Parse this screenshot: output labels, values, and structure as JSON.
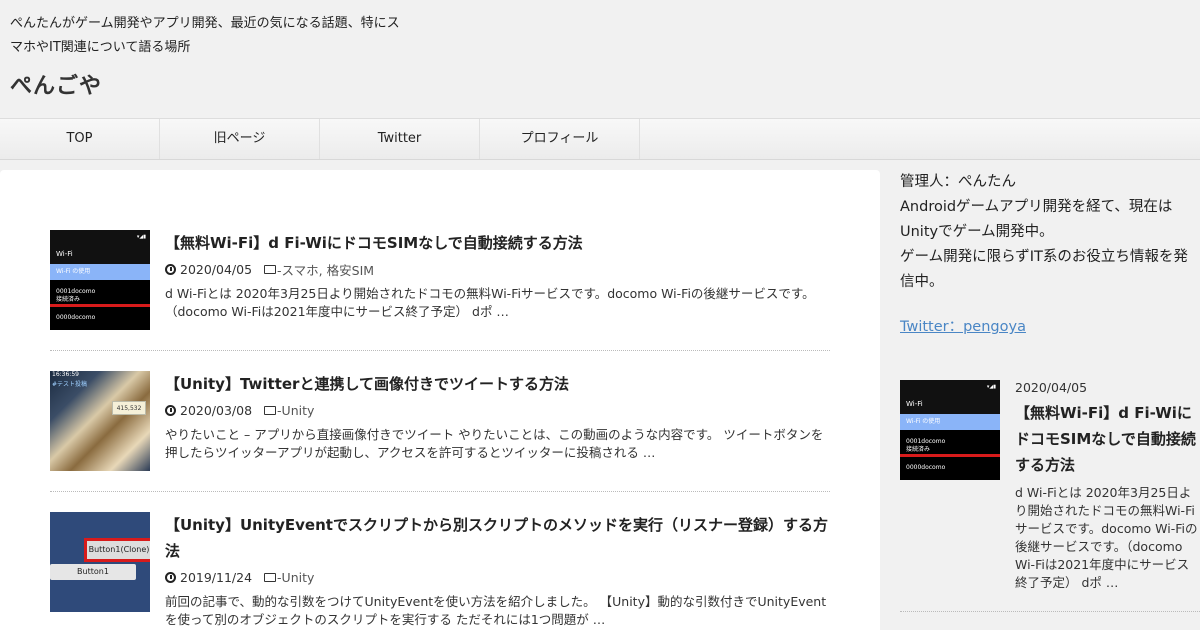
{
  "header": {
    "tagline": "ぺんたんがゲーム開発やアプリ開発、最近の気になる話題、特にスマホやIT関連について語る場所",
    "site_title": "ぺんごや"
  },
  "nav": {
    "items": [
      {
        "label": "TOP"
      },
      {
        "label": "旧ページ"
      },
      {
        "label": "Twitter"
      },
      {
        "label": "プロフィール"
      }
    ]
  },
  "posts": [
    {
      "title": "【無料Wi-Fi】d Fi-WiにドコモSIMなしで自動接続する方法",
      "date": "2020/04/05",
      "categories": "-スマホ, 格安SIM",
      "excerpt": "d Wi-Fiとは 2020年3月25日より開始されたドコモの無料Wi-Fiサービスです。docomo Wi-Fiの後継サービスです。（docomo Wi-Fiは2021年度中にサービス終了予定） dポ …",
      "thumb": {
        "head": "Wi-Fi",
        "menu": "Wi-Fi の使用",
        "ssid1": "0001docomo",
        "status": "接続済み",
        "ssid2": "0000docomo"
      }
    },
    {
      "title": "【Unity】Twitterと連携して画像付きでツイートする方法",
      "date": "2020/03/08",
      "categories": "-Unity",
      "excerpt": "やりたいこと – アプリから直接画像付きでツイート やりたいことは、この動画のような内容です。 ツイートボタンを押したらツイッターアプリが起動し、アクセスを許可するとツイッターに投稿される …",
      "thumb": {
        "time": "16:36:59",
        "tag": "#テスト投稿",
        "badge": "415,532"
      }
    },
    {
      "title": "【Unity】UnityEventでスクリプトから別スクリプトのメソッドを実行（リスナー登録）する方法",
      "date": "2019/11/24",
      "categories": "-Unity",
      "excerpt": "前回の記事で、動的な引数をつけてUnityEventを使い方法を紹介しました。 【Unity】動的な引数付きでUnityEventを使って別のオブジェクトのスクリプトを実行する ただそれには1つ問題が …",
      "thumb": {
        "btn1": "Button1(Clone)",
        "btn2": "Button1"
      }
    }
  ],
  "sidebar": {
    "profile_lines": [
      "管理人：ぺんたん",
      "Androidゲームアプリ開発を経て、現在はUnityでゲーム開発中。",
      "ゲーム開発に限らずIT系のお役立ち情報を発信中。"
    ],
    "twitter_link": "Twitter：pengoya",
    "recent": {
      "date": "2020/04/05",
      "title": "【無料Wi-Fi】d Fi-WiにドコモSIMなしで自動接続する方法",
      "excerpt": "d Wi-Fiとは 2020年3月25日より開始されたドコモの無料Wi-Fiサービスです。docomo Wi-Fiの後継サービスです。（docomo Wi-Fiは2021年度中にサービス終了予定） dポ …"
    }
  }
}
